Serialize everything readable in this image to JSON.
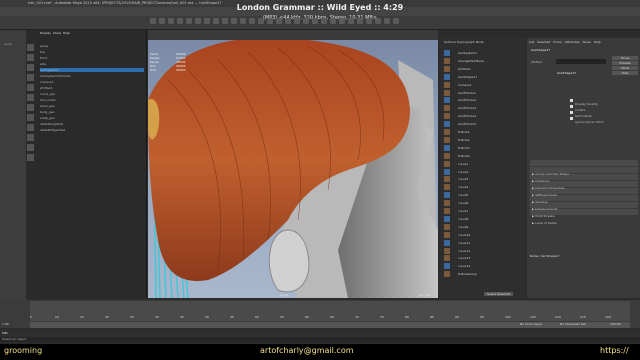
{
  "window": {
    "title": "hair_001.ma* - Autodesk Maya 2015 x64: /PROJECTS/2015/HAIR_PROJECT/scenes/hair_001.ma --- hairShape17"
  },
  "now_playing": {
    "title": "London Grammar :: Wild Eyed :: 4:29",
    "details": "(MP3) <44 kHz, 320 kbps, Stereo, 10.31 MB>"
  },
  "outliner": {
    "menus": [
      "Display",
      "Show",
      "Help"
    ],
    "items": [
      "persp",
      "top",
      "front",
      "side",
      "hairSystem1",
      "hairSystem1Follicles",
      "nucleus1",
      "pfxHair1",
      "curve_grp",
      "hair_mesh",
      "head_geo",
      "body_geo",
      "scalp_geo",
      "defaultLightSet",
      "defaultObjectSet"
    ]
  },
  "viewport": {
    "hud_labels": [
      "Verts:",
      "Edges:",
      "Faces:",
      "Tris:",
      "UVs:"
    ],
    "hud_values": [
      "28502",
      "57004",
      "28502",
      "56994",
      "28900"
    ],
    "footer_camera": "persp",
    "footer_fps": "16.7 fps"
  },
  "nodes": {
    "header": "Outliner  Hypergraph  Node",
    "items": [
      "hairSystem1",
      "ChangeHairMode",
      "pfxHair1",
      "hairShape17",
      "nucleus1",
      "hairFollicle1",
      "hairFollicle2",
      "hairFollicle3",
      "hairFollicle4",
      "hairFollicle5",
      "follicle1",
      "follicle2",
      "follicle3",
      "follicle4",
      "curve1",
      "curve2",
      "curve3",
      "curve4",
      "curve5",
      "curve6",
      "curve7",
      "curve8",
      "curve9",
      "curve10",
      "curve11",
      "curve12",
      "curve13",
      "curve14",
      "follicleGroup"
    ],
    "footer_button": "Select Selected"
  },
  "attribute_editor": {
    "tabs": [
      "List",
      "Selected",
      "Focus",
      "Attributes",
      "Show",
      "Help"
    ],
    "node_label": "hairShape17",
    "shape_label": "pfxHair:",
    "buttons": [
      "Focus",
      "Presets",
      "Show",
      "Hide"
    ],
    "sections": [
      "Clump and Hair Shape",
      "Collisions",
      "Dynamic Properties",
      "Stiffness Scale",
      "Shading",
      "Displacements",
      "Multi Streaks",
      "Level of Detail"
    ],
    "checkboxes": [
      "Display Quality",
      "Collide",
      "Self Collide",
      "Ignore Solver Wind"
    ],
    "bottom_buttons": [
      "Select",
      "Load Attributes",
      "Copy Tab"
    ],
    "notes_label": "Notes: hairShape17"
  },
  "timeline": {
    "ticks": [
      "5",
      "10",
      "15",
      "20",
      "25",
      "30",
      "35",
      "40",
      "45",
      "50",
      "55",
      "60",
      "65",
      "70",
      "75",
      "80",
      "85",
      "90",
      "95",
      "100",
      "105",
      "110",
      "115",
      "120"
    ],
    "start": "1.00",
    "end": "120.00",
    "current": "1.00",
    "anim_layer": "No Anim Layer",
    "char_set": "No Character Set"
  },
  "command_line": {
    "lang": "MEL",
    "help": "Select an object"
  },
  "caption": {
    "left": "grooming",
    "center": "artofcharly@gmail.com",
    "right": "https://"
  },
  "colors": {
    "hair": "#b8542a",
    "accent": "#2c6db0",
    "caption_text": "#f4e08a"
  }
}
